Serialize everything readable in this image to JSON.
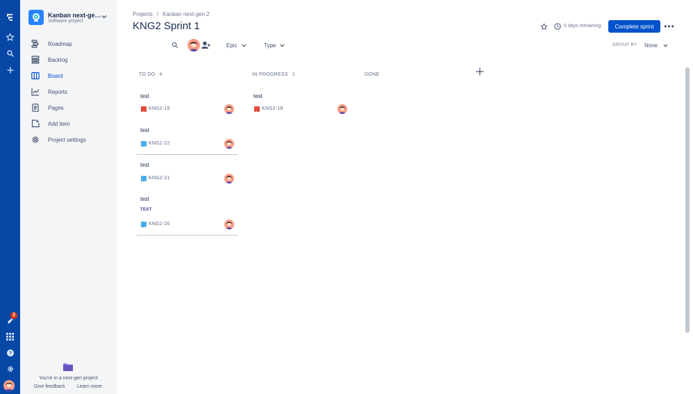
{
  "global_nav": {
    "icons": [
      "jira-logo-icon",
      "star-icon",
      "search-icon",
      "plus-icon",
      "notification-icon",
      "app-switcher-icon",
      "help-icon",
      "settings-icon"
    ],
    "notification_count": "3"
  },
  "sidebar": {
    "project_name": "Kanban next-ge…",
    "project_type": "Software project",
    "items": [
      {
        "label": "Roadmap",
        "icon": "roadmap-icon"
      },
      {
        "label": "Backlog",
        "icon": "backlog-icon"
      },
      {
        "label": "Board",
        "icon": "board-icon",
        "active": true
      },
      {
        "label": "Reports",
        "icon": "reports-icon"
      },
      {
        "label": "Pages",
        "icon": "pages-icon"
      },
      {
        "label": "Add item",
        "icon": "add-item-icon"
      },
      {
        "label": "Project settings",
        "icon": "gear-icon"
      }
    ],
    "footer_text": "You're in a next-gen project",
    "give_feedback": "Give feedback",
    "learn_more": "Learn more"
  },
  "header": {
    "breadcrumb": [
      "Projects",
      "Kanban next-gen 2"
    ],
    "breadcrumb_sep": "/",
    "title": "KNG2 Sprint 1",
    "days_remaining": "0 days remaining",
    "complete_label": "Complete sprint",
    "more_label": "•••"
  },
  "filters": {
    "epic": "Epic",
    "type": "Type",
    "group_by_label": "GROUP BY",
    "group_by_value": "None"
  },
  "columns": [
    {
      "name": "TO DO",
      "count": "4"
    },
    {
      "name": "IN PROGRESS",
      "count": "1"
    },
    {
      "name": "DONE",
      "count": ""
    }
  ],
  "cards": {
    "todo": [
      {
        "summary": "test",
        "key": "KNG2-19",
        "type": "bug"
      },
      {
        "summary": "test",
        "key": "KNG2-22",
        "type": "task"
      },
      {
        "summary": "test",
        "key": "KNG2-21",
        "type": "task"
      },
      {
        "summary": "test",
        "tag": "TEST",
        "key": "KNG2-20",
        "type": "task"
      }
    ],
    "in_progress": [
      {
        "summary": "test",
        "key": "KNG2-18",
        "type": "bug"
      }
    ]
  },
  "colors": {
    "nav_blue": "#0747A6",
    "primary": "#0052CC",
    "bug_red": "#E5493A",
    "task_blue": "#4BADE8"
  }
}
